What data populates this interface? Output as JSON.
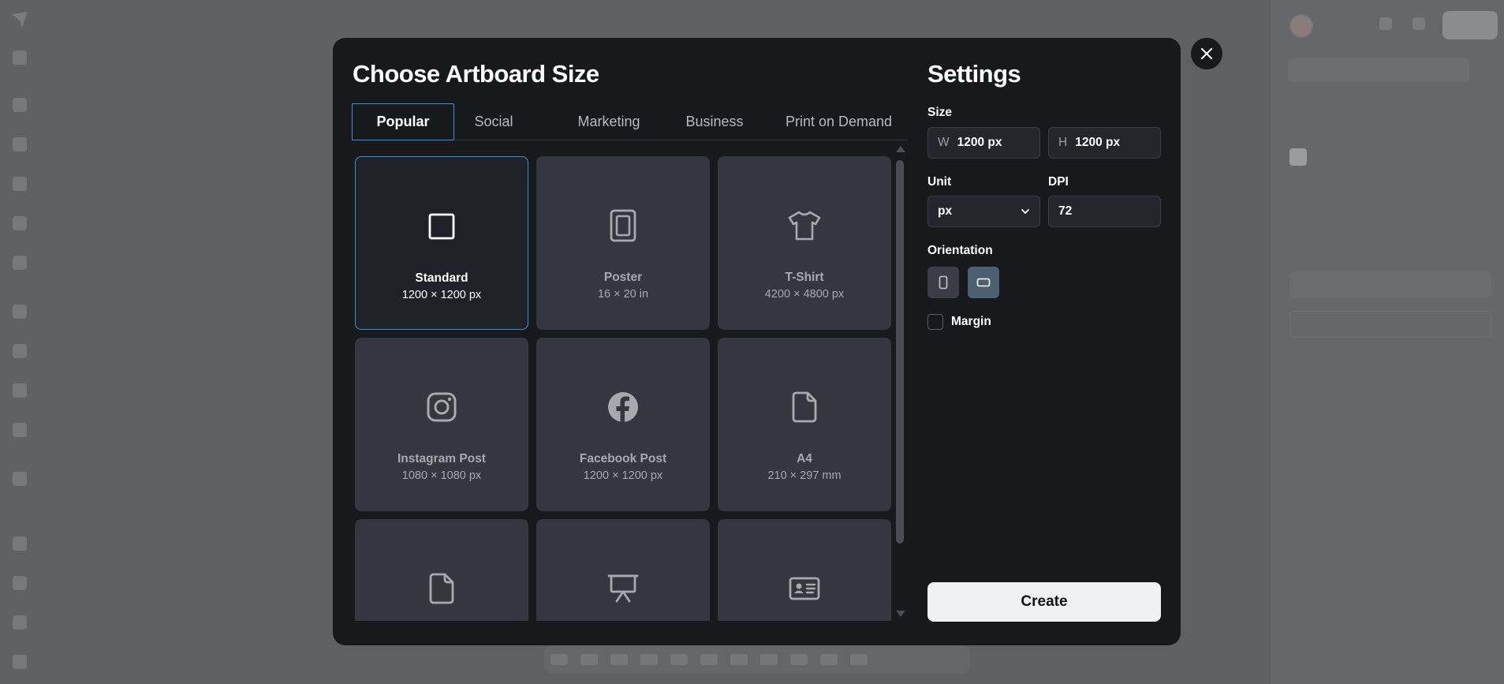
{
  "modal": {
    "title": "Choose Artboard Size",
    "tabs": [
      {
        "label": "Popular",
        "active": true
      },
      {
        "label": "Social",
        "active": false
      },
      {
        "label": "Marketing",
        "active": false
      },
      {
        "label": "Business",
        "active": false
      },
      {
        "label": "Print on Demand",
        "active": false
      }
    ],
    "cards": [
      {
        "name": "Standard",
        "dims": "1200 × 1200 px",
        "icon": "square-icon",
        "selected": true
      },
      {
        "name": "Poster",
        "dims": "16 × 20 in",
        "icon": "poster-icon",
        "selected": false
      },
      {
        "name": "T-Shirt",
        "dims": "4200 × 4800 px",
        "icon": "tshirt-icon",
        "selected": false
      },
      {
        "name": "Instagram Post",
        "dims": "1080 × 1080 px",
        "icon": "instagram-icon",
        "selected": false
      },
      {
        "name": "Facebook Post",
        "dims": "1200 × 1200 px",
        "icon": "facebook-icon",
        "selected": false
      },
      {
        "name": "A4",
        "dims": "210 × 297 mm",
        "icon": "document-icon",
        "selected": false
      },
      {
        "name": "",
        "dims": "",
        "icon": "document-icon",
        "selected": false
      },
      {
        "name": "",
        "dims": "",
        "icon": "presentation-icon",
        "selected": false
      },
      {
        "name": "",
        "dims": "",
        "icon": "id-card-icon",
        "selected": false
      }
    ]
  },
  "settings": {
    "title": "Settings",
    "size_label": "Size",
    "width_prefix": "W",
    "width_value": "1200 px",
    "height_prefix": "H",
    "height_value": "1200 px",
    "unit_label": "Unit",
    "unit_value": "px",
    "dpi_label": "DPI",
    "dpi_value": "72",
    "orientation_label": "Orientation",
    "orientation_selected": "landscape",
    "margin_label": "Margin",
    "margin_checked": false,
    "create_label": "Create"
  },
  "colors": {
    "accent": "#3d8fd9",
    "modal_bg": "#18191d",
    "card_bg": "#353740",
    "overlay": "#5c5d61"
  }
}
